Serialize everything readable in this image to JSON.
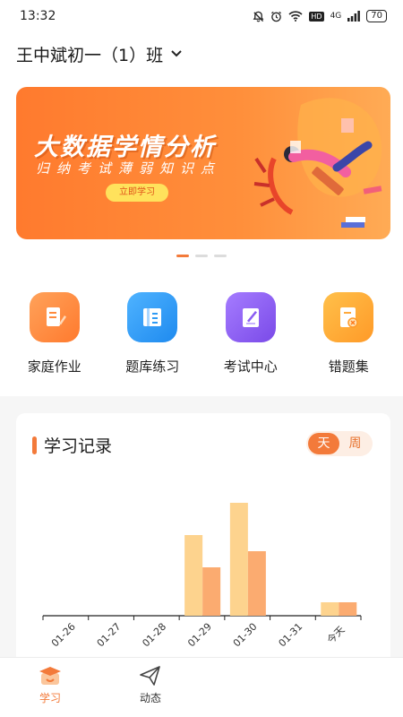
{
  "status_bar": {
    "time": "13:32",
    "network": "4G",
    "hd": "HD",
    "battery": "70"
  },
  "class_selector": {
    "name": "王中斌初一（1）班"
  },
  "banner": {
    "title": "大数据学情分析",
    "subtitle": "归纳考试薄弱知识点",
    "button": "立即学习",
    "page_count": 3,
    "active_index": 0
  },
  "features": [
    {
      "label": "家庭作业",
      "icon": "homework-icon",
      "color": "#ff8a3d"
    },
    {
      "label": "题库练习",
      "icon": "question-bank-icon",
      "color": "#2f9bf4"
    },
    {
      "label": "考试中心",
      "icon": "exam-center-icon",
      "color": "#8a5cf2"
    },
    {
      "label": "错题集",
      "icon": "mistake-book-icon",
      "color": "#ffa93a"
    }
  ],
  "record": {
    "title": "学习记录",
    "toggle": {
      "day": "天",
      "week": "周",
      "selected": "天"
    }
  },
  "chart_data": {
    "type": "bar",
    "categories": [
      "01-26",
      "01-27",
      "01-28",
      "01-29",
      "01-30",
      "01-31",
      "今天"
    ],
    "series": [
      {
        "values": [
          0,
          0,
          0,
          60,
          84,
          0,
          10
        ],
        "color": "#fdd38e"
      },
      {
        "values": [
          0,
          0,
          0,
          36,
          48,
          0,
          10
        ],
        "color": "#fbab70"
      }
    ],
    "ylim": [
      0,
      100
    ],
    "grid": false
  },
  "tabbar": {
    "items": [
      {
        "label": "学习",
        "icon": "study-icon",
        "active": true
      },
      {
        "label": "动态",
        "icon": "paper-plane-icon",
        "active": false
      }
    ],
    "accent": "#f37a3a"
  }
}
